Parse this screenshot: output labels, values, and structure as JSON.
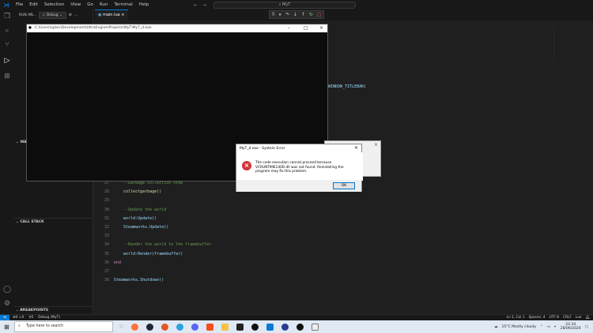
{
  "menu": [
    "File",
    "Edit",
    "Selection",
    "View",
    "Go",
    "Run",
    "Terminal",
    "Help"
  ],
  "search": "MyT",
  "run": {
    "label": "RUN AN...",
    "config": "Debug"
  },
  "tab": "main.lua",
  "sidebar": {
    "watch": "WA",
    "callstack": "CALL STACK",
    "breakpoints": "BREAKPOINTS"
  },
  "console": {
    "title": "C:\\Users\\oplec\\Development\\UltraEngine\\Projects\\MyT\\MyT_d.exe"
  },
  "code_fragment": "WINDOW_TITLEBAR)",
  "code": [
    {
      "n": "27",
      "t": "    --Garbage collection step",
      "c": "cm"
    },
    {
      "n": "28",
      "t": "    collectgarbage()",
      "c": "fn"
    },
    {
      "n": "29",
      "t": "",
      "c": ""
    },
    {
      "n": "30",
      "t": "    --Update the world",
      "c": "cm"
    },
    {
      "n": "31",
      "t": "    world:Update()",
      "c": "id"
    },
    {
      "n": "32",
      "t": "    Steamworks.Update()",
      "c": "id"
    },
    {
      "n": "33",
      "t": "",
      "c": ""
    },
    {
      "n": "34",
      "t": "    --Render the world to the framebuffer",
      "c": "cm"
    },
    {
      "n": "35",
      "t": "    world:Render(framebuffer)",
      "c": "id"
    },
    {
      "n": "36",
      "t": "end",
      "c": "kw"
    },
    {
      "n": "37",
      "t": "",
      "c": ""
    },
    {
      "n": "38",
      "t": "Steamworks.Shutdown()",
      "c": "id"
    }
  ],
  "dialog": {
    "title": "MyT_d.exe - System Error",
    "message": "The code execution cannot proceed because VCRUNTIME140D.dll was not found. Reinstalling the program may fix this problem.",
    "ok": "OK"
  },
  "status": {
    "errors": "0",
    "warnings": "0",
    "ports": "0",
    "debug": "Debug (MyT)",
    "position": "Ln 1, Col 1",
    "spaces": "Spaces: 4",
    "encoding": "UTF-8",
    "eol": "CRLF",
    "lang": "Lua"
  },
  "taskbar": {
    "search_placeholder": "Type here to search",
    "weather": "15°C  Mostly cloudy",
    "time": "22:34",
    "date": "28/06/2024"
  }
}
